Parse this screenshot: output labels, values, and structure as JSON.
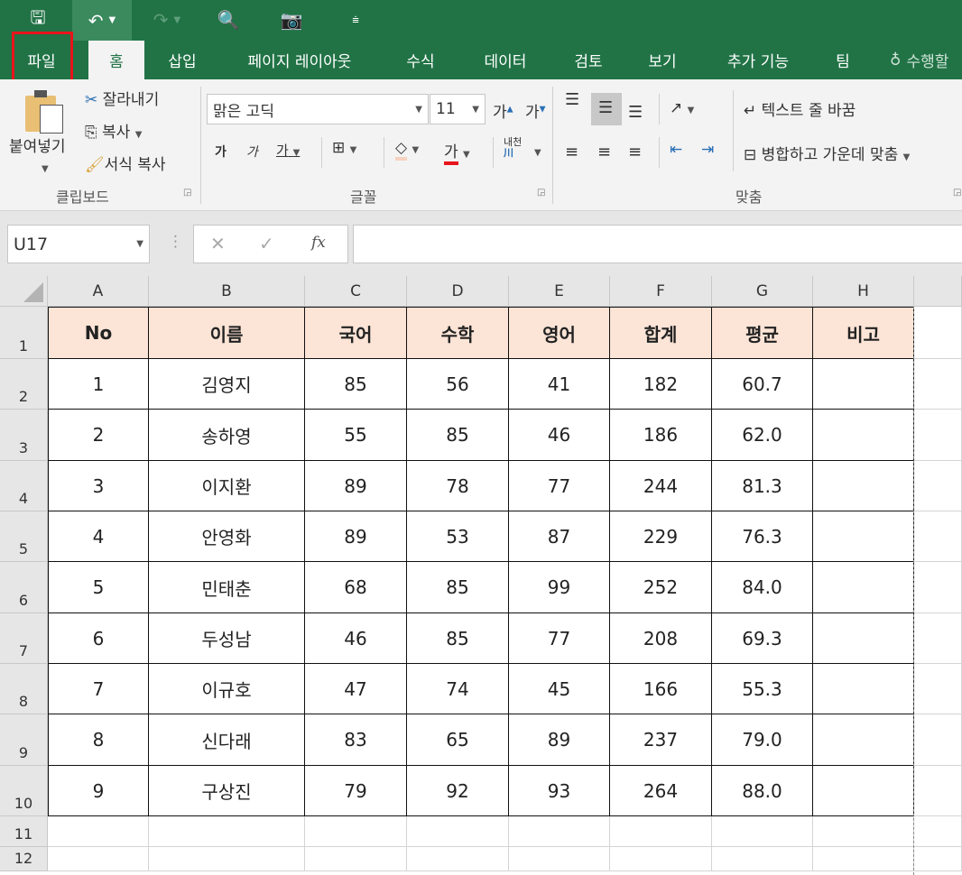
{
  "quick_access": {
    "icons": [
      "save-icon",
      "undo-icon",
      "redo-icon",
      "print-preview-icon",
      "camera-icon",
      "customize-icon"
    ]
  },
  "tabs": [
    "파일",
    "홈",
    "삽입",
    "페이지 레이아웃",
    "수식",
    "데이터",
    "검토",
    "보기",
    "추가 기능",
    "팀"
  ],
  "tell_me": "수행할",
  "ribbon": {
    "paste": "붙여넣기",
    "cut": "잘라내기",
    "copy": "복사",
    "format_painter": "서식 복사",
    "clipboard_label": "클립보드",
    "font_name": "맑은 고딕",
    "font_size": "11",
    "grow": "가",
    "shrink": "가",
    "bold": "가",
    "italic": "가",
    "underline": "가",
    "font_color_glyph": "가",
    "phonetic": "내천",
    "font_label": "글꼴",
    "wrap_text": "텍스트 줄 바꿈",
    "merge_center": "병합하고 가운데 맞춤",
    "alignment_label": "맞춤"
  },
  "colors": {
    "brand": "#217346",
    "header_fill": "#fce4d6",
    "highlight": "#e8141b",
    "font_color": "#e8141b"
  },
  "formula_bar": {
    "name_box": "U17",
    "formula": "",
    "fx": "fx"
  },
  "columns": [
    "A",
    "B",
    "C",
    "D",
    "E",
    "F",
    "G",
    "H"
  ],
  "rows": [
    "1",
    "2",
    "3",
    "4",
    "5",
    "6",
    "7",
    "8",
    "9",
    "10",
    "11",
    "12"
  ],
  "table": {
    "headers": [
      "No",
      "이름",
      "국어",
      "수학",
      "영어",
      "합계",
      "평균",
      "비고"
    ],
    "data": [
      [
        "1",
        "김영지",
        "85",
        "56",
        "41",
        "182",
        "60.7",
        ""
      ],
      [
        "2",
        "송하영",
        "55",
        "85",
        "46",
        "186",
        "62.0",
        ""
      ],
      [
        "3",
        "이지환",
        "89",
        "78",
        "77",
        "244",
        "81.3",
        ""
      ],
      [
        "4",
        "안영화",
        "89",
        "53",
        "87",
        "229",
        "76.3",
        ""
      ],
      [
        "5",
        "민태춘",
        "68",
        "85",
        "99",
        "252",
        "84.0",
        ""
      ],
      [
        "6",
        "두성남",
        "46",
        "85",
        "77",
        "208",
        "69.3",
        ""
      ],
      [
        "7",
        "이규호",
        "47",
        "74",
        "45",
        "166",
        "55.3",
        ""
      ],
      [
        "8",
        "신다래",
        "83",
        "65",
        "89",
        "237",
        "79.0",
        ""
      ],
      [
        "9",
        "구상진",
        "79",
        "92",
        "93",
        "264",
        "88.0",
        ""
      ]
    ]
  }
}
